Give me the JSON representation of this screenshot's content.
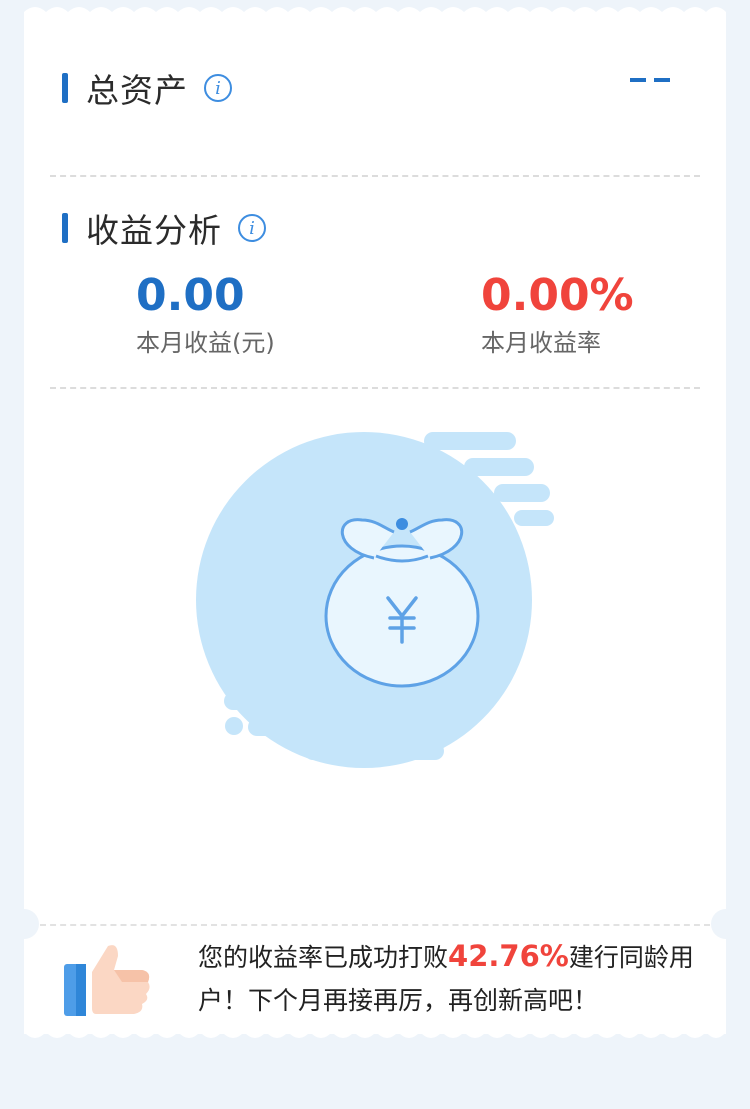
{
  "total_assets": {
    "title": "总资产",
    "info_icon": "info-icon",
    "value_placeholder": "--"
  },
  "income_analysis": {
    "title": "收益分析",
    "info_icon": "info-icon",
    "monthly_income": {
      "value": "0.00",
      "label": "本月收益(元)",
      "color": "#1f6fc4"
    },
    "monthly_rate": {
      "value": "0.00%",
      "label": "本月收益率",
      "color": "#f0443c"
    }
  },
  "illustration": {
    "icon": "money-bag-icon",
    "symbol": "¥"
  },
  "footer": {
    "icon": "thumbs-up-icon",
    "text_before": "您的收益率已成功打败",
    "highlight": "42.76%",
    "text_after": "建行同龄用户！下个月再接再厉，再创新高吧！"
  },
  "colors": {
    "accent": "#1f6fc4",
    "negative": "#f0443c",
    "illustration": "#c5e5fa"
  }
}
